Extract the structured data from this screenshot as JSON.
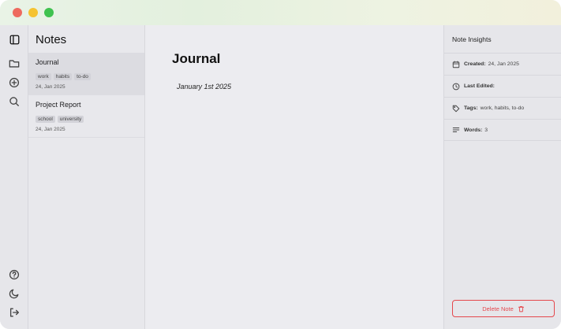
{
  "window": {
    "controls": [
      "close",
      "minimize",
      "maximize"
    ]
  },
  "rail": {
    "top_icons": [
      "sidebar-toggle-icon",
      "folder-icon",
      "add-circle-icon",
      "search-icon"
    ],
    "bottom_icons": [
      "help-icon",
      "moon-icon",
      "logout-icon"
    ]
  },
  "notes_panel": {
    "title": "Notes",
    "items": [
      {
        "name": "Journal",
        "tags": [
          "work",
          "habits",
          "to-do"
        ],
        "date": "24, Jan 2025",
        "active": true
      },
      {
        "name": "Project Report",
        "tags": [
          "school",
          "university"
        ],
        "date": "24, Jan 2025",
        "active": false
      }
    ]
  },
  "editor": {
    "title": "Journal",
    "body": "January 1st 2025"
  },
  "insights": {
    "title": "Note Insights",
    "created_label": "Created:",
    "created_value": "24, Jan 2025",
    "edited_label": "Last Edited:",
    "edited_value": "",
    "tags_label": "Tags:",
    "tags_value": "work, habits, to-do",
    "words_label": "Words:",
    "words_value": "3",
    "delete_label": "Delete Note"
  },
  "colors": {
    "accent_danger": "#e5484d",
    "close": "#ee6a5f",
    "minimize": "#f5c331",
    "maximize": "#3fc24f"
  }
}
